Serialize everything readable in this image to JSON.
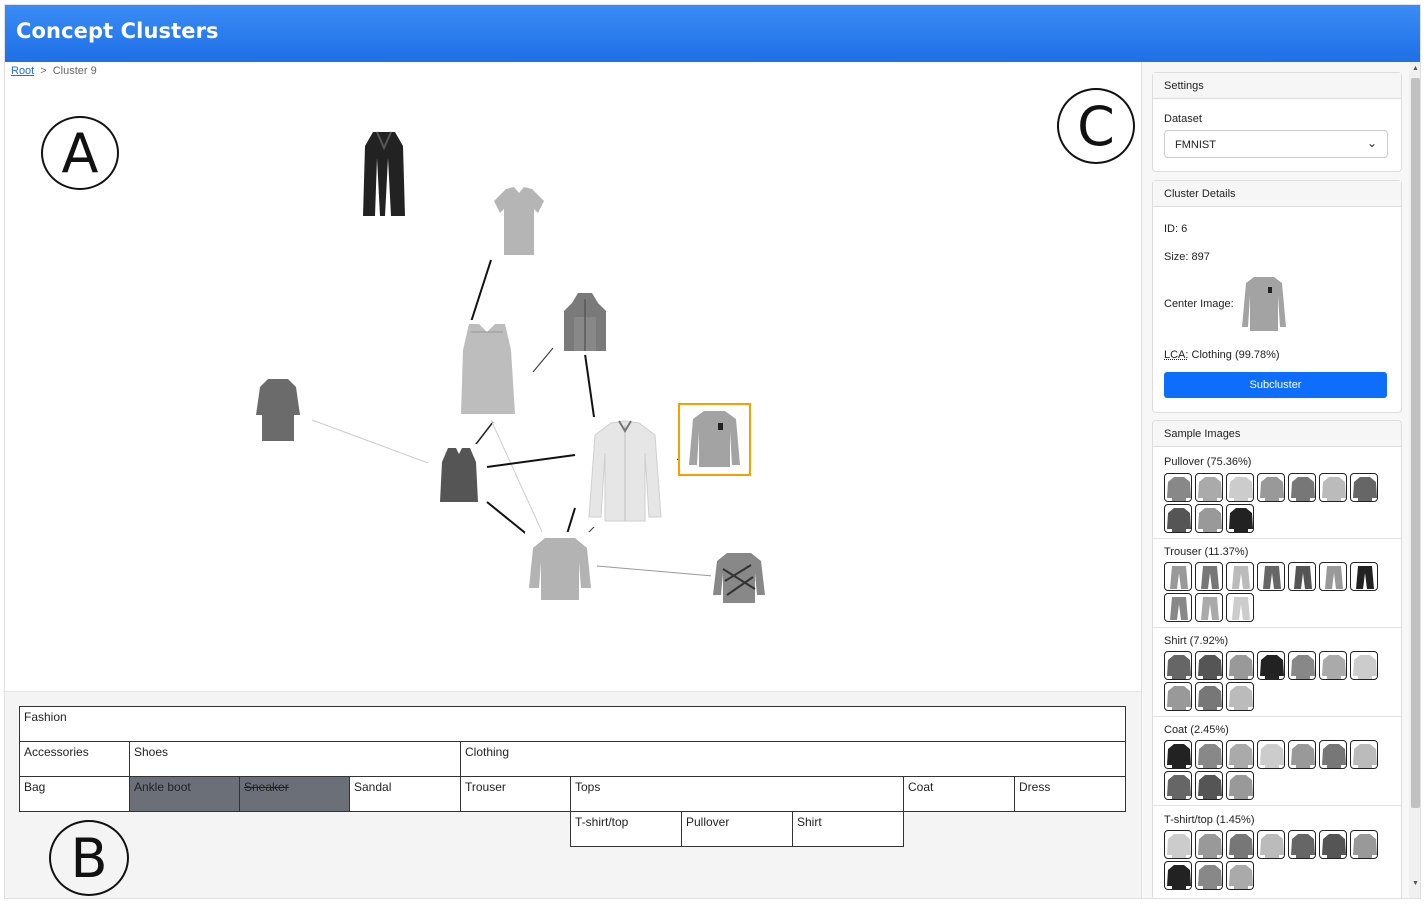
{
  "app": {
    "title": "Concept Clusters"
  },
  "breadcrumb": {
    "root": "Root",
    "separator": ">",
    "current": "Cluster 9"
  },
  "markers": {
    "a": "A",
    "b": "B",
    "c": "C"
  },
  "hierarchy": {
    "root": "Fashion",
    "level1": [
      "Accessories",
      "Shoes",
      "Clothing"
    ],
    "level2": [
      "Bag",
      "Ankle boot",
      "Sneaker",
      "Sandal",
      "Trouser",
      "Tops",
      "Coat",
      "Dress"
    ],
    "level3": [
      "T-shirt/top",
      "Pullover",
      "Shirt"
    ],
    "highlighted": [
      "Ankle boot",
      "Sneaker"
    ],
    "struck": [
      "Sneaker"
    ]
  },
  "settings": {
    "header": "Settings",
    "dataset_label": "Dataset",
    "dataset_value": "FMNIST"
  },
  "cluster_details": {
    "header": "Cluster Details",
    "id": "ID: 6",
    "size": "Size: 897",
    "center_label": "Center Image:",
    "lca_prefix": "LCA:",
    "lca_value": "Clothing (99.78%)",
    "subcluster_button": "Subcluster"
  },
  "sample_images": {
    "header": "Sample Images",
    "groups": [
      {
        "title": "Pullover (75.36%)",
        "count": 10
      },
      {
        "title": "Trouser (11.37%)",
        "count": 10
      },
      {
        "title": "Shirt (7.92%)",
        "count": 10
      },
      {
        "title": "Coat (2.45%)",
        "count": 10
      },
      {
        "title": "T-shirt/top (1.45%)",
        "count": 10
      }
    ]
  },
  "colors": {
    "accent": "#1f6fe6",
    "button": "#0d6efd",
    "selected": "#f5a000",
    "highlight_cell": "#6b7078"
  }
}
